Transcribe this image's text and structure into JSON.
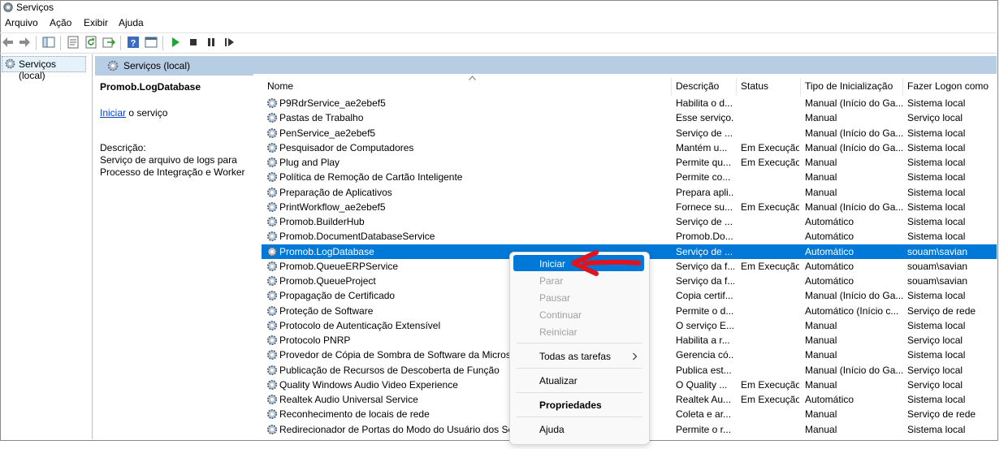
{
  "window": {
    "title": "Serviços"
  },
  "menu": [
    "Arquivo",
    "Ação",
    "Exibir",
    "Ajuda"
  ],
  "toolbar": {
    "icons": [
      "back-arrow-icon",
      "forward-arrow-icon",
      "console-tree-icon",
      "properties-icon",
      "refresh-icon",
      "export-icon",
      "help-icon",
      "console-icon",
      "start-icon",
      "stop-icon",
      "pause-icon",
      "restart-icon"
    ]
  },
  "tree": {
    "item": "Serviços (local)"
  },
  "header": {
    "title": "Serviços (local)"
  },
  "details": {
    "service_name": "Promob.LogDatabase",
    "action_link": "Iniciar",
    "action_suffix": " o serviço",
    "description_label": "Descrição:",
    "description": "Serviço de arquivo de logs para Processo de Integração e Worker"
  },
  "columns": [
    "Nome",
    "Descrição",
    "Status",
    "Tipo de Inicialização",
    "Fazer Logon como"
  ],
  "rows": [
    [
      "P9RdrService_ae2ebef5",
      "Habilita o d...",
      "",
      "Manual (Início do Ga...",
      "Sistema local"
    ],
    [
      "Pastas de Trabalho",
      "Esse serviço...",
      "",
      "Manual",
      "Serviço local"
    ],
    [
      "PenService_ae2ebef5",
      "Serviço de ...",
      "",
      "Manual (Início do Ga...",
      "Sistema local"
    ],
    [
      "Pesquisador de Computadores",
      "Mantém u...",
      "Em Execução",
      "Manual (Início do Ga...",
      "Sistema local"
    ],
    [
      "Plug and Play",
      "Permite qu...",
      "Em Execução",
      "Manual",
      "Sistema local"
    ],
    [
      "Política de Remoção de Cartão Inteligente",
      "Permite co...",
      "",
      "Manual",
      "Sistema local"
    ],
    [
      "Preparação de Aplicativos",
      "Prepara apli...",
      "",
      "Manual",
      "Sistema local"
    ],
    [
      "PrintWorkflow_ae2ebef5",
      "Fornece su...",
      "Em Execução",
      "Manual (Início do Ga...",
      "Sistema local"
    ],
    [
      "Promob.BuilderHub",
      "Serviço de ...",
      "",
      "Automático",
      "Sistema local"
    ],
    [
      "Promob.DocumentDatabaseService",
      "Promob.Do...",
      "",
      "Automático",
      "Sistema local"
    ],
    [
      "Promob.LogDatabase",
      "Serviço de ...",
      "",
      "Automático",
      "souam\\savian"
    ],
    [
      "Promob.QueueERPService",
      "Serviço da f...",
      "Em Execução",
      "Automático",
      "souam\\savian"
    ],
    [
      "Promob.QueueProject",
      "Serviço da f...",
      "",
      "Automático",
      "souam\\savian"
    ],
    [
      "Propagação de Certificado",
      "Copia certif...",
      "",
      "Manual (Início do Ga...",
      "Sistema local"
    ],
    [
      "Proteção de Software",
      "Permite o d...",
      "",
      "Automático (Início c...",
      "Serviço de rede"
    ],
    [
      "Protocolo de Autenticação Extensível",
      "O serviço E...",
      "",
      "Manual",
      "Sistema local"
    ],
    [
      "Protocolo PNRP",
      "Habilita a r...",
      "",
      "Manual",
      "Serviço local"
    ],
    [
      "Provedor de Cópia de Sombra de Software da Microsoft",
      "Gerencia có...",
      "",
      "Manual",
      "Sistema local"
    ],
    [
      "Publicação de Recursos de Descoberta de Função",
      "Publica est...",
      "",
      "Manual (Início do Ga...",
      "Serviço local"
    ],
    [
      "Quality Windows Audio Video Experience",
      "O Quality ...",
      "Em Execução",
      "Manual",
      "Serviço local"
    ],
    [
      "Realtek Audio Universal Service",
      "Realtek Au...",
      "Em Execução",
      "Automático",
      "Sistema local"
    ],
    [
      "Reconhecimento de locais de rede",
      "Coleta e ar...",
      "",
      "Manual",
      "Serviço de rede"
    ],
    [
      "Redirecionador de Portas do Modo do Usuário dos Servi...",
      "Permite o r...",
      "",
      "Manual",
      "Sistema local"
    ]
  ],
  "selected_row_index": 10,
  "context_menu": {
    "items": [
      {
        "label": "Iniciar",
        "enabled": true,
        "highlighted": true
      },
      {
        "label": "Parar",
        "enabled": false
      },
      {
        "label": "Pausar",
        "enabled": false
      },
      {
        "label": "Continuar",
        "enabled": false
      },
      {
        "label": "Reiniciar",
        "enabled": false
      },
      {
        "label": "Todas as tarefas",
        "enabled": true,
        "submenu": true
      },
      {
        "label": "Atualizar",
        "enabled": true
      },
      {
        "label": "Propriedades",
        "enabled": true,
        "bold": true
      },
      {
        "label": "Ajuda",
        "enabled": true
      }
    ]
  },
  "colors": {
    "selection": "#0078d7",
    "header_band": "#b7cde3",
    "link": "#0044cc",
    "annotation_arrow": "#e0141e"
  }
}
